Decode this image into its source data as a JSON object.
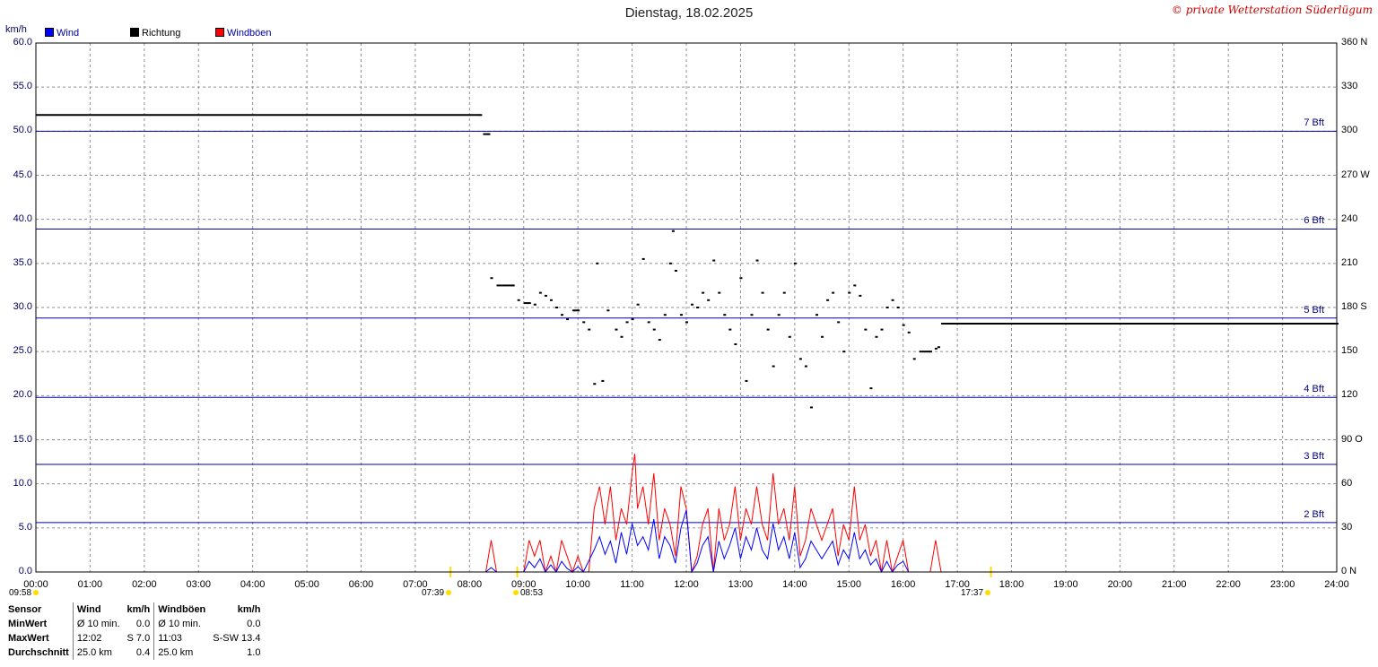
{
  "title": "Dienstag, 18.02.2025",
  "copyright": "© private Wetterstation Süderlügum",
  "unit_left": "km/h",
  "legend": [
    {
      "label": "Wind",
      "color": "#0000ff"
    },
    {
      "label": "Richtung",
      "color": "#000000"
    },
    {
      "label": "Windböen",
      "color": "#ff0000"
    }
  ],
  "colors": {
    "grid": "#909090",
    "bft": "#0000aa",
    "wind": "#0000ff",
    "gust": "#ff0000",
    "direction": "#000000",
    "sun": "#ffdd00"
  },
  "y_left_ticks": [
    "60.0",
    "55.0",
    "50.0",
    "45.0",
    "40.0",
    "35.0",
    "30.0",
    "25.0",
    "20.0",
    "15.0",
    "10.0",
    "5.0",
    "0.0"
  ],
  "y_right_ticks": [
    "360 N",
    "330",
    "300",
    "270 W",
    "240",
    "210",
    "180 S",
    "150",
    "120",
    "90 O",
    "60",
    "30",
    "0  N"
  ],
  "x_ticks": [
    "00:00",
    "01:00",
    "02:00",
    "03:00",
    "04:00",
    "05:00",
    "06:00",
    "07:00",
    "08:00",
    "09:00",
    "10:00",
    "11:00",
    "12:00",
    "13:00",
    "14:00",
    "15:00",
    "16:00",
    "17:00",
    "18:00",
    "19:00",
    "20:00",
    "21:00",
    "22:00",
    "23:00",
    "24:00"
  ],
  "bft_lines": [
    {
      "label": "7 Bft",
      "value": 50.0
    },
    {
      "label": "6 Bft",
      "value": 38.9
    },
    {
      "label": "5 Bft",
      "value": 28.8
    },
    {
      "label": "4 Bft",
      "value": 19.8
    },
    {
      "label": "3 Bft",
      "value": 12.2
    },
    {
      "label": "2 Bft",
      "value": 5.6
    }
  ],
  "sun": {
    "moonset": "09:58",
    "sunrise": "07:39",
    "moonrise_label": "08:53",
    "sunset": "17:37",
    "sunrise_hour": 7.65,
    "moon_hour": 8.88,
    "sunset_hour": 17.62
  },
  "chart_data": {
    "type": "line",
    "title": "Dienstag, 18.02.2025",
    "xlabel": "",
    "ylabel": "km/h",
    "x_range_hours": [
      0,
      24
    ],
    "ylim": [
      0,
      60
    ],
    "y2lim": [
      0,
      360
    ],
    "grid": true,
    "legend_position": "top-left",
    "series": [
      {
        "name": "Richtung",
        "axis": "right",
        "style": "points",
        "points": [
          [
            0,
            311
          ],
          [
            8.2,
            311
          ],
          [
            8.25,
            298
          ],
          [
            8.35,
            298
          ],
          [
            8.4,
            200
          ],
          [
            8.5,
            195
          ],
          [
            8.6,
            195
          ],
          [
            8.8,
            195
          ],
          [
            8.9,
            185
          ],
          [
            9.0,
            183
          ],
          [
            9.1,
            183
          ],
          [
            9.2,
            182
          ],
          [
            9.3,
            190
          ],
          [
            9.4,
            188
          ],
          [
            9.5,
            185
          ],
          [
            9.6,
            180
          ],
          [
            9.7,
            175
          ],
          [
            9.8,
            172
          ],
          [
            9.9,
            178
          ],
          [
            10.0,
            178
          ],
          [
            10.1,
            170
          ],
          [
            10.2,
            165
          ],
          [
            10.3,
            128
          ],
          [
            10.35,
            210
          ],
          [
            10.45,
            130
          ],
          [
            10.55,
            178
          ],
          [
            10.7,
            165
          ],
          [
            10.8,
            160
          ],
          [
            10.9,
            170
          ],
          [
            11.0,
            172
          ],
          [
            11.1,
            182
          ],
          [
            11.2,
            213
          ],
          [
            11.3,
            170
          ],
          [
            11.4,
            165
          ],
          [
            11.5,
            158
          ],
          [
            11.6,
            175
          ],
          [
            11.7,
            210
          ],
          [
            11.75,
            232
          ],
          [
            11.8,
            205
          ],
          [
            11.9,
            175
          ],
          [
            12.0,
            170
          ],
          [
            12.1,
            182
          ],
          [
            12.2,
            180
          ],
          [
            12.3,
            190
          ],
          [
            12.4,
            185
          ],
          [
            12.5,
            212
          ],
          [
            12.6,
            190
          ],
          [
            12.7,
            175
          ],
          [
            12.8,
            165
          ],
          [
            12.9,
            155
          ],
          [
            13.0,
            200
          ],
          [
            13.1,
            130
          ],
          [
            13.2,
            175
          ],
          [
            13.3,
            212
          ],
          [
            13.4,
            190
          ],
          [
            13.5,
            165
          ],
          [
            13.6,
            140
          ],
          [
            13.7,
            175
          ],
          [
            13.8,
            190
          ],
          [
            13.9,
            160
          ],
          [
            14.0,
            210
          ],
          [
            14.1,
            145
          ],
          [
            14.2,
            140
          ],
          [
            14.3,
            112
          ],
          [
            14.4,
            175
          ],
          [
            14.5,
            160
          ],
          [
            14.6,
            185
          ],
          [
            14.7,
            190
          ],
          [
            14.8,
            170
          ],
          [
            14.9,
            150
          ],
          [
            15.0,
            190
          ],
          [
            15.1,
            195
          ],
          [
            15.2,
            188
          ],
          [
            15.3,
            165
          ],
          [
            15.4,
            125
          ],
          [
            15.5,
            160
          ],
          [
            15.6,
            165
          ],
          [
            15.7,
            180
          ],
          [
            15.8,
            185
          ],
          [
            15.9,
            180
          ],
          [
            16.0,
            168
          ],
          [
            16.1,
            163
          ],
          [
            16.2,
            145
          ],
          [
            16.3,
            150
          ],
          [
            16.5,
            150
          ],
          [
            16.6,
            152
          ],
          [
            16.65,
            153
          ],
          [
            16.7,
            169
          ],
          [
            24,
            169
          ]
        ]
      },
      {
        "name": "Windböen",
        "axis": "left",
        "style": "line",
        "points": [
          [
            8.3,
            0
          ],
          [
            8.4,
            3.6
          ],
          [
            8.5,
            0
          ],
          [
            9.0,
            0
          ],
          [
            9.1,
            3.6
          ],
          [
            9.2,
            1.8
          ],
          [
            9.3,
            3.6
          ],
          [
            9.4,
            0
          ],
          [
            9.5,
            1.8
          ],
          [
            9.6,
            0
          ],
          [
            9.7,
            3.6
          ],
          [
            9.8,
            1.8
          ],
          [
            9.9,
            0
          ],
          [
            10.0,
            1.8
          ],
          [
            10.1,
            0
          ],
          [
            10.2,
            0
          ],
          [
            10.3,
            7.2
          ],
          [
            10.4,
            9.7
          ],
          [
            10.5,
            5.4
          ],
          [
            10.6,
            9.7
          ],
          [
            10.7,
            3.6
          ],
          [
            10.8,
            7.2
          ],
          [
            10.9,
            5.4
          ],
          [
            11.0,
            11.2
          ],
          [
            11.05,
            13.4
          ],
          [
            11.1,
            7.2
          ],
          [
            11.2,
            9.7
          ],
          [
            11.3,
            5.4
          ],
          [
            11.4,
            11.2
          ],
          [
            11.5,
            3.6
          ],
          [
            11.6,
            7.2
          ],
          [
            11.7,
            5.4
          ],
          [
            11.8,
            1.8
          ],
          [
            11.9,
            9.7
          ],
          [
            12.0,
            7.2
          ],
          [
            12.1,
            0
          ],
          [
            12.2,
            1.8
          ],
          [
            12.3,
            5.4
          ],
          [
            12.4,
            7.2
          ],
          [
            12.5,
            0
          ],
          [
            12.6,
            7.2
          ],
          [
            12.7,
            3.6
          ],
          [
            12.8,
            5.4
          ],
          [
            12.9,
            9.7
          ],
          [
            13.0,
            3.6
          ],
          [
            13.1,
            7.2
          ],
          [
            13.2,
            5.4
          ],
          [
            13.3,
            9.7
          ],
          [
            13.4,
            5.4
          ],
          [
            13.5,
            3.6
          ],
          [
            13.6,
            11.2
          ],
          [
            13.7,
            5.4
          ],
          [
            13.8,
            7.2
          ],
          [
            13.9,
            3.6
          ],
          [
            14.0,
            9.7
          ],
          [
            14.1,
            1.8
          ],
          [
            14.2,
            3.6
          ],
          [
            14.3,
            7.2
          ],
          [
            14.4,
            5.4
          ],
          [
            14.5,
            3.6
          ],
          [
            14.6,
            5.4
          ],
          [
            14.7,
            7.2
          ],
          [
            14.8,
            1.8
          ],
          [
            14.9,
            5.4
          ],
          [
            15.0,
            3.6
          ],
          [
            15.1,
            9.7
          ],
          [
            15.2,
            3.6
          ],
          [
            15.3,
            5.4
          ],
          [
            15.4,
            1.8
          ],
          [
            15.5,
            3.6
          ],
          [
            15.6,
            0
          ],
          [
            15.7,
            3.6
          ],
          [
            15.8,
            0
          ],
          [
            15.9,
            1.8
          ],
          [
            16.0,
            3.6
          ],
          [
            16.1,
            0
          ],
          [
            16.5,
            0
          ],
          [
            16.6,
            3.6
          ],
          [
            16.7,
            0
          ]
        ]
      },
      {
        "name": "Wind",
        "axis": "left",
        "style": "line",
        "points": [
          [
            8.3,
            0
          ],
          [
            8.4,
            0.5
          ],
          [
            8.5,
            0
          ],
          [
            9.0,
            0
          ],
          [
            9.1,
            1.2
          ],
          [
            9.2,
            0.5
          ],
          [
            9.3,
            1.5
          ],
          [
            9.4,
            0
          ],
          [
            9.5,
            0.8
          ],
          [
            9.6,
            0
          ],
          [
            9.7,
            1.2
          ],
          [
            9.8,
            0.4
          ],
          [
            9.9,
            0
          ],
          [
            10.0,
            0.6
          ],
          [
            10.1,
            0
          ],
          [
            10.3,
            2.5
          ],
          [
            10.4,
            4.0
          ],
          [
            10.5,
            2.0
          ],
          [
            10.6,
            3.5
          ],
          [
            10.7,
            1.0
          ],
          [
            10.8,
            4.5
          ],
          [
            10.9,
            2.0
          ],
          [
            11.0,
            5.5
          ],
          [
            11.1,
            3.0
          ],
          [
            11.2,
            4.0
          ],
          [
            11.3,
            2.5
          ],
          [
            11.4,
            6.0
          ],
          [
            11.5,
            1.5
          ],
          [
            11.6,
            4.0
          ],
          [
            11.7,
            3.0
          ],
          [
            11.8,
            1.0
          ],
          [
            11.9,
            5.0
          ],
          [
            12.0,
            7.0
          ],
          [
            12.1,
            0
          ],
          [
            12.2,
            1.0
          ],
          [
            12.3,
            3.0
          ],
          [
            12.4,
            4.0
          ],
          [
            12.5,
            0
          ],
          [
            12.6,
            3.5
          ],
          [
            12.7,
            1.5
          ],
          [
            12.8,
            3.0
          ],
          [
            12.9,
            5.0
          ],
          [
            13.0,
            1.5
          ],
          [
            13.1,
            4.0
          ],
          [
            13.2,
            2.5
          ],
          [
            13.3,
            5.0
          ],
          [
            13.4,
            2.5
          ],
          [
            13.5,
            1.5
          ],
          [
            13.6,
            5.5
          ],
          [
            13.7,
            2.5
          ],
          [
            13.8,
            4.0
          ],
          [
            13.9,
            1.5
          ],
          [
            14.0,
            4.5
          ],
          [
            14.1,
            0.5
          ],
          [
            14.2,
            1.5
          ],
          [
            14.3,
            3.5
          ],
          [
            14.4,
            2.5
          ],
          [
            14.5,
            1.5
          ],
          [
            14.6,
            2.5
          ],
          [
            14.7,
            3.5
          ],
          [
            14.8,
            0.8
          ],
          [
            14.9,
            2.5
          ],
          [
            15.0,
            1.5
          ],
          [
            15.1,
            4.5
          ],
          [
            15.2,
            1.5
          ],
          [
            15.3,
            2.5
          ],
          [
            15.4,
            0.8
          ],
          [
            15.5,
            1.5
          ],
          [
            15.6,
            0
          ],
          [
            15.7,
            1.2
          ],
          [
            15.8,
            0
          ],
          [
            15.9,
            0.8
          ],
          [
            16.0,
            1.2
          ],
          [
            16.1,
            0
          ]
        ]
      }
    ]
  },
  "stats": {
    "header": [
      "Sensor",
      "Wind",
      "km/h",
      "Windböen",
      "km/h"
    ],
    "rows": [
      [
        "MinWert",
        "Ø 10 min.",
        "0.0",
        "Ø 10 min.",
        "0.0"
      ],
      [
        "MaxWert",
        "12:02",
        "S 7.0",
        "11:03",
        "S-SW 13.4"
      ],
      [
        "Durchschnitt",
        "25.0 km",
        "0.4",
        "25.0 km",
        "1.0"
      ]
    ]
  }
}
